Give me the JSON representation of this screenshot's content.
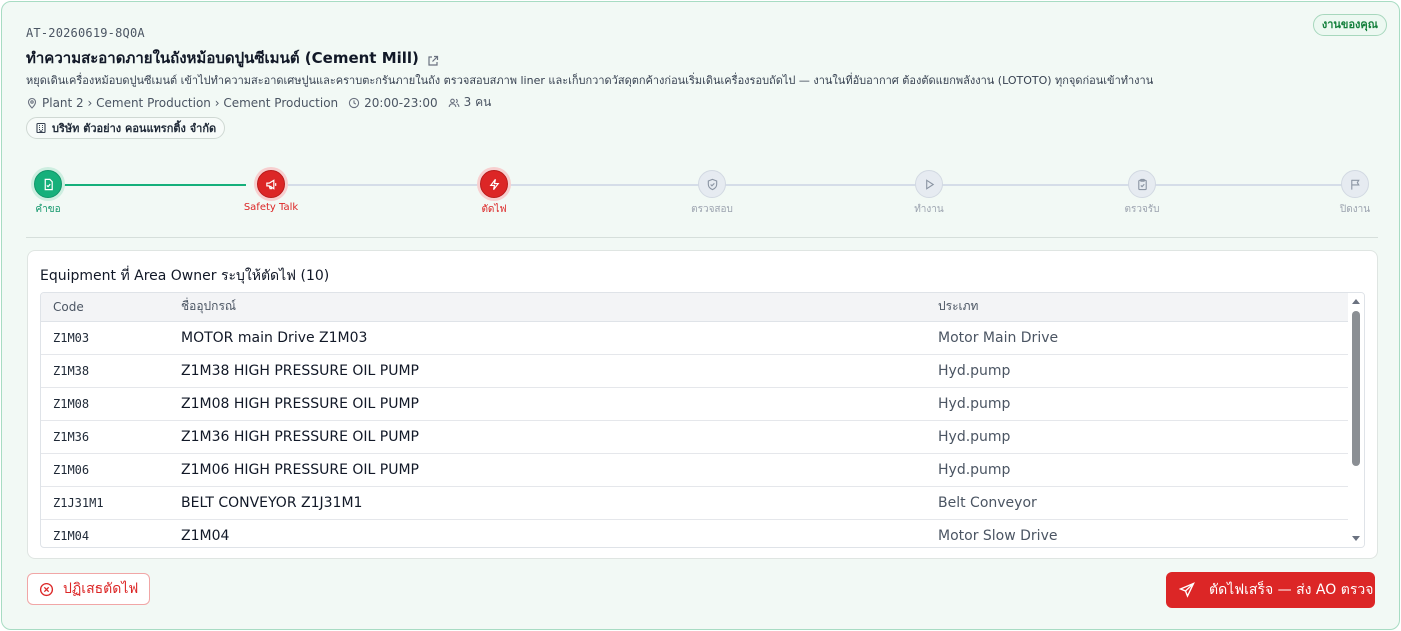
{
  "header": {
    "doc_id": "AT-20260619-8Q0A",
    "badge": "งานของคุณ",
    "title": "ทำความสะอาดภายในถังหม้อบดปูนซีเมนต์ (Cement Mill)",
    "description": "หยุดเดินเครื่องหม้อบดปูนซีเมนต์ เข้าไปทำความสะอาดเศษปูนและคราบตะกรันภายในถัง ตรวจสอบสภาพ liner และเก็บกวาดวัสดุตกค้างก่อนเริ่มเดินเครื่องรอบถัดไป — งานในที่อับอากาศ ต้องตัดแยกพลังงาน (LOTOTO) ทุกจุดก่อนเข้าทำงาน",
    "location": "Plant 2 › Cement Production › Cement Production",
    "time": "20:00-23:00",
    "people": "3 คน",
    "company": "บริษัท ตัวอย่าง คอนแทรกติ้ง จำกัด"
  },
  "stepper": {
    "steps": [
      {
        "label": "คำขอ",
        "status": "done"
      },
      {
        "label": "Safety Talk",
        "status": "active"
      },
      {
        "label": "ตัดไฟ",
        "status": "active"
      },
      {
        "label": "ตรวจสอบ",
        "status": "pending"
      },
      {
        "label": "ทำงาน",
        "status": "pending"
      },
      {
        "label": "ตรวจรับ",
        "status": "pending"
      },
      {
        "label": "ปิดงาน",
        "status": "pending"
      }
    ]
  },
  "equipment": {
    "title": "Equipment ที่ Area Owner ระบุให้ตัดไฟ (10)",
    "columns": [
      "Code",
      "ชื่ออุปกรณ์",
      "ประเภท"
    ],
    "rows": [
      {
        "code": "Z1M03",
        "name": "MOTOR main Drive Z1M03",
        "type": "Motor Main Drive"
      },
      {
        "code": "Z1M38",
        "name": "Z1M38 HIGH PRESSURE OIL PUMP",
        "type": "Hyd.pump"
      },
      {
        "code": "Z1M08",
        "name": "Z1M08 HIGH PRESSURE OIL PUMP",
        "type": "Hyd.pump"
      },
      {
        "code": "Z1M36",
        "name": "Z1M36 HIGH PRESSURE OIL PUMP",
        "type": "Hyd.pump"
      },
      {
        "code": "Z1M06",
        "name": "Z1M06 HIGH PRESSURE OIL PUMP",
        "type": "Hyd.pump"
      },
      {
        "code": "Z1J31M1",
        "name": "BELT CONVEYOR Z1J31M1",
        "type": "Belt Conveyor"
      },
      {
        "code": "Z1M04",
        "name": "Z1M04",
        "type": "Motor Slow Drive"
      }
    ]
  },
  "actions": {
    "reject_label": "ปฏิเสธตัดไฟ",
    "done_label": "ตัดไฟเสร็จ — ส่ง AO ตรวจ"
  },
  "colors": {
    "accent_green": "#16b07b",
    "accent_red": "#dc2626",
    "card_bg": "#f2f9f5"
  }
}
